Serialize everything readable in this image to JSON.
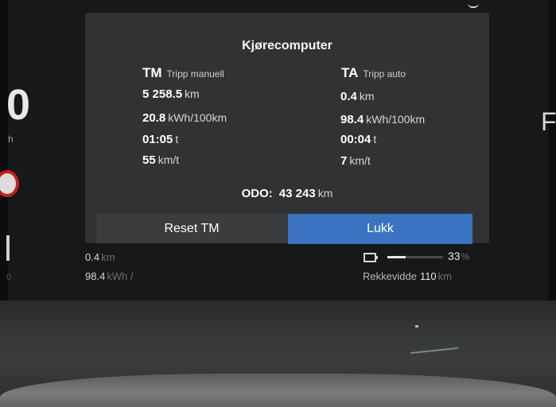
{
  "trip_computer": {
    "title": "Kjørecomputer",
    "tm": {
      "code": "TM",
      "label": "Tripp manuell",
      "distance": "5 258.5",
      "distance_unit": "km",
      "consumption": "20.8",
      "consumption_unit": "kWh/100km",
      "time": "01:05",
      "time_unit": "t",
      "speed": "55",
      "speed_unit": "km/t"
    },
    "ta": {
      "code": "TA",
      "label": "Tripp auto",
      "distance": "0.4",
      "distance_unit": "km",
      "consumption": "98.4",
      "consumption_unit": "kWh/100km",
      "time": "00:04",
      "time_unit": "t",
      "speed": "7",
      "speed_unit": "km/t"
    },
    "odo": {
      "label": "ODO:",
      "value": "43 243",
      "unit": "km"
    },
    "buttons": {
      "reset": "Reset TM",
      "close": "Lukk"
    }
  },
  "cluster": {
    "left_digit": "0",
    "left_unit": "h",
    "right_letter": "F",
    "left_zero": "0",
    "trip_distance": "0.4",
    "trip_distance_unit": "km",
    "trip_consumption": "98.4",
    "trip_consumption_unit": "kWh /",
    "battery_percent": "33",
    "battery_percent_unit": "%",
    "battery_level": 0.33,
    "range_label": "Rekkevidde",
    "range_value": "110",
    "range_unit": "km"
  },
  "colors": {
    "accent": "#3b73c2",
    "panel": "#303233",
    "background": "#161819"
  }
}
